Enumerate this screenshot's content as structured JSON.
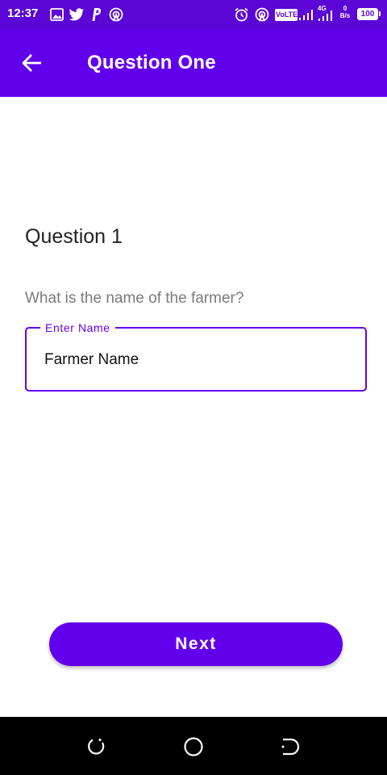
{
  "status_bar": {
    "time": "12:37",
    "left_icons": [
      "gallery-icon",
      "twitter-icon",
      "paypal-icon",
      "hotspot-icon"
    ],
    "right_icons": [
      "alarm-icon",
      "hotspot-icon",
      "volte-icon",
      "signal-icon",
      "signal-icon",
      "data-speed-icon",
      "battery-icon"
    ],
    "volte": "VoLTE",
    "network": "4G",
    "data_rate_value": "0",
    "data_rate_unit": "B/s",
    "battery": "100"
  },
  "app_bar": {
    "title": "Question One",
    "back_icon": "arrow-back-icon",
    "color": "#6200ee"
  },
  "content": {
    "question_title": "Question 1",
    "question_text": "What is the name of the farmer?",
    "field": {
      "label": "Enter Name",
      "value": "Farmer Name"
    },
    "next_button": "Next"
  },
  "nav_bar": {
    "buttons": [
      "recents-icon",
      "home-icon",
      "back-icon"
    ]
  },
  "colors": {
    "status_bar": "#5b05d6",
    "accent": "#6200ee",
    "text_primary": "#222222",
    "text_secondary": "#7a7a7a"
  }
}
